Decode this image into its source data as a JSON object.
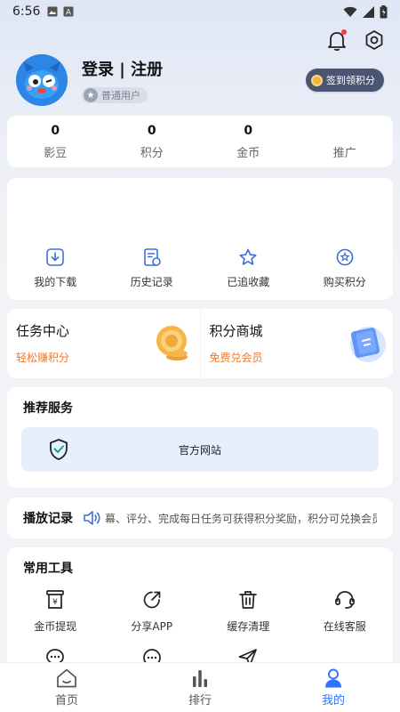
{
  "status_bar": {
    "time": "6:56"
  },
  "profile": {
    "login_text": "登录 | 注册",
    "user_level": "普通用户",
    "checkin_label": "签到领积分"
  },
  "stats": [
    {
      "value": "0",
      "label": "影豆"
    },
    {
      "value": "0",
      "label": "积分"
    },
    {
      "value": "0",
      "label": "金币"
    },
    {
      "value": "",
      "label": "推广"
    }
  ],
  "quick_actions": [
    {
      "label": "我的下载",
      "icon": "download-icon"
    },
    {
      "label": "历史记录",
      "icon": "history-icon"
    },
    {
      "label": "已追收藏",
      "icon": "star-icon"
    },
    {
      "label": "购买积分",
      "icon": "points-icon"
    }
  ],
  "promos": {
    "task_center": {
      "title": "任务中心",
      "subtitle": "轻松赚积分"
    },
    "points_mall": {
      "title": "积分商城",
      "subtitle": "免费兑会员"
    }
  },
  "services": {
    "title": "推荐服务",
    "item": "官方网站"
  },
  "history": {
    "title": "播放记录",
    "marquee": "幕、评分、完成每日任务可获得积分奖励，积分可兑换会员"
  },
  "tools": {
    "title": "常用工具",
    "items": [
      {
        "label": "金币提现",
        "icon": "withdraw-icon"
      },
      {
        "label": "分享APP",
        "icon": "share-icon"
      },
      {
        "label": "缓存清理",
        "icon": "trash-icon"
      },
      {
        "label": "在线客服",
        "icon": "headset-icon"
      },
      {
        "label": "",
        "icon": "chat-icon"
      },
      {
        "label": "",
        "icon": "message-icon"
      },
      {
        "label": "",
        "icon": "send-icon"
      }
    ]
  },
  "tabbar": [
    {
      "label": "首页",
      "icon": "home-icon"
    },
    {
      "label": "排行",
      "icon": "ranking-icon"
    },
    {
      "label": "我的",
      "icon": "profile-icon",
      "active": true
    }
  ],
  "colors": {
    "accent": "#2f74ff",
    "orange": "#ee7a2e",
    "checkin_bg": "#4a5572"
  }
}
